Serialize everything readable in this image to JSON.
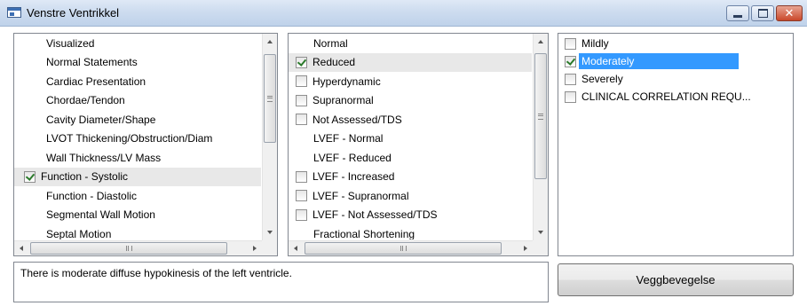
{
  "window": {
    "title": "Venstre Ventrikkel"
  },
  "panel_categories": {
    "items": [
      {
        "label": "Visualized",
        "checkbox": false
      },
      {
        "label": "Normal Statements",
        "checkbox": false
      },
      {
        "label": "Cardiac Presentation",
        "checkbox": false
      },
      {
        "label": "Chordae/Tendon",
        "checkbox": false
      },
      {
        "label": "Cavity Diameter/Shape",
        "checkbox": false
      },
      {
        "label": "LVOT Thickening/Obstruction/Diam",
        "checkbox": false
      },
      {
        "label": "Wall Thickness/LV Mass",
        "checkbox": false
      },
      {
        "label": "Function - Systolic",
        "checkbox": true,
        "checked": true,
        "selected": true
      },
      {
        "label": "Function - Diastolic",
        "checkbox": false
      },
      {
        "label": "Segmental Wall Motion",
        "checkbox": false
      },
      {
        "label": "Septal Motion",
        "checkbox": false
      }
    ]
  },
  "panel_findings": {
    "items": [
      {
        "label": "Normal",
        "checkbox": false
      },
      {
        "label": "Reduced",
        "checkbox": true,
        "checked": true,
        "selected": true
      },
      {
        "label": "Hyperdynamic",
        "checkbox": true,
        "checked": false
      },
      {
        "label": "Supranormal",
        "checkbox": true,
        "checked": false
      },
      {
        "label": "Not Assessed/TDS",
        "checkbox": true,
        "checked": false
      },
      {
        "label": "LVEF - Normal",
        "checkbox": false
      },
      {
        "label": "LVEF - Reduced",
        "checkbox": false
      },
      {
        "label": "LVEF - Increased",
        "checkbox": true,
        "checked": false
      },
      {
        "label": "LVEF - Supranormal",
        "checkbox": true,
        "checked": false
      },
      {
        "label": "LVEF - Not Assessed/TDS",
        "checkbox": true,
        "checked": false
      },
      {
        "label": "Fractional Shortening",
        "checkbox": false
      }
    ]
  },
  "panel_severity": {
    "items": [
      {
        "label": "Mildly",
        "checked": false,
        "highlighted": false
      },
      {
        "label": "Moderately",
        "checked": true,
        "highlighted": true
      },
      {
        "label": "Severely",
        "checked": false,
        "highlighted": false
      },
      {
        "label": "CLINICAL CORRELATION REQU...",
        "checked": false,
        "highlighted": false
      }
    ]
  },
  "hscroll_label": "III",
  "statement_text": "There is moderate diffuse hypokinesis of the left ventricle.",
  "action_button": {
    "label": "Veggbevegelse"
  }
}
